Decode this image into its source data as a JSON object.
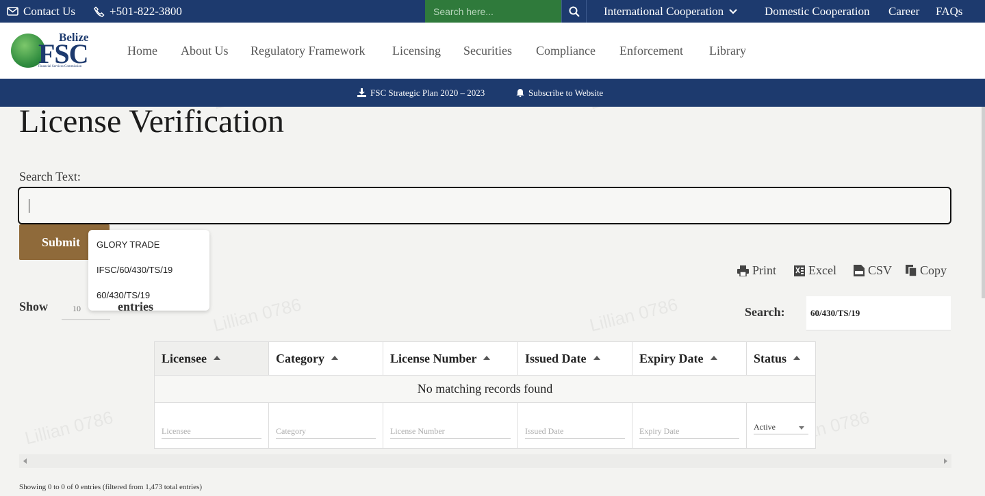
{
  "topbar": {
    "contact_label": "Contact Us",
    "phone": "+501-822-3800",
    "search_placeholder": "Search here...",
    "links": [
      "International Cooperation",
      "Domestic Cooperation",
      "Career",
      "FAQs"
    ]
  },
  "logo": {
    "top": "Belize",
    "main": "FSC",
    "sub": "Financial Services Commission"
  },
  "nav": [
    "Home",
    "About Us",
    "Regulatory Framework",
    "Licensing",
    "Securities",
    "Compliance",
    "Enforcement",
    "Library"
  ],
  "strip": {
    "plan_label": "FSC Strategic Plan 2020 – 2023",
    "subscribe_label": "Subscribe to Website"
  },
  "page": {
    "title": "License Verification",
    "search_label": "Search Text:",
    "search_value": "",
    "submit_label": "Submit"
  },
  "autocomplete": [
    "GLORY TRADE",
    " IFSC/60/430/TS/19",
    "60/430/TS/19"
  ],
  "exports": [
    "Print",
    "Excel",
    "CSV",
    "Copy"
  ],
  "length": {
    "show_label": "Show",
    "value": "10",
    "suffix": "entries"
  },
  "dt_search": {
    "label": "Search:",
    "value": "60/430/TS/19"
  },
  "table": {
    "columns": [
      "Licensee",
      "Category",
      "License Number",
      "Issued Date",
      "Expiry Date",
      "Status"
    ],
    "empty_message": "No matching records found",
    "filter_placeholders": [
      "Licensee",
      "Category",
      "License Number",
      "Issued Date",
      "Expiry Date"
    ],
    "status_filter": "Active"
  },
  "info": "Showing 0 to 0 of 0 entries (filtered from 1,473 total entries)",
  "watermark": "Lillian 0786",
  "colors": {
    "navy": "#1d3a6e",
    "green": "#2f7a3b",
    "gold": "#8f6a3a"
  }
}
